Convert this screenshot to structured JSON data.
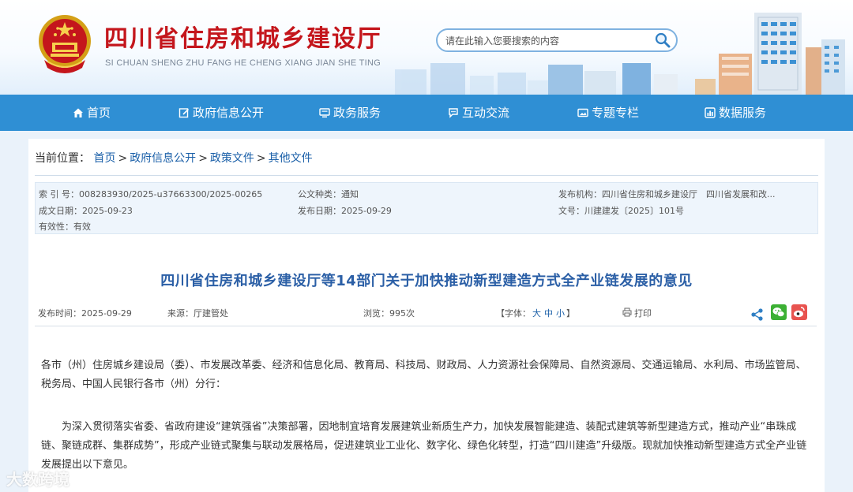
{
  "header": {
    "title": "四川省住房和城乡建设厅",
    "subtitle": "SI CHUAN SHENG ZHU FANG HE CHENG XIANG JIAN SHE TING",
    "search_placeholder": "请在此输入您要搜索的内容",
    "brand_color": "#c4161c"
  },
  "nav": {
    "color": "#2f8fd4",
    "items": [
      {
        "label": "首页",
        "icon": "home-icon"
      },
      {
        "label": "政府信息公开",
        "icon": "edit-icon"
      },
      {
        "label": "政务服务",
        "icon": "monitor-icon"
      },
      {
        "label": "互动交流",
        "icon": "chat-icon"
      },
      {
        "label": "专题专栏",
        "icon": "picture-icon"
      },
      {
        "label": "数据服务",
        "icon": "chart-icon"
      }
    ]
  },
  "breadcrumb": {
    "prefix": "当前位置：",
    "items": [
      "首页",
      "政府信息公开",
      "政策文件",
      "其他文件"
    ],
    "separator": ">"
  },
  "meta": {
    "index_no": "索 引 号：008283930/2025-u37663300/2025-00265",
    "doc_type": "公文种类：通知",
    "publisher": "发布机构：四川省住房和城乡建设厅　四川省发展和改...",
    "written_date": "成文日期：2025-09-23",
    "publish_date": "发布日期：2025-09-29",
    "doc_no": "文号：川建建发〔2025〕101号",
    "validity": "有效性：有效"
  },
  "article": {
    "title": "四川省住房和城乡建设厅等14部门关于加快推动新型建造方式全产业链发展的意见",
    "publish_time": "发布时间：2025-09-29",
    "source": "来源：厅建管处",
    "views": "浏览：995次",
    "font_label_prefix": "【字体：",
    "font_large": "大",
    "font_medium": "中",
    "font_small": "小",
    "font_label_suffix": "】",
    "print_label": "打印",
    "paragraph_1": "各市（州）住房城乡建设局（委）、市发展改革委、经济和信息化局、教育局、科技局、财政局、人力资源社会保障局、自然资源局、交通运输局、水利局、市场监管局、税务局、中国人民银行各市（州）分行：",
    "paragraph_2": "为深入贯彻落实省委、省政府建设“建筑强省”决策部署，因地制宜培育发展建筑业新质生产力，加快发展智能建造、装配式建筑等新型建造方式，推动产业“串珠成链、聚链成群、集群成势”，形成产业链式聚集与联动发展格局，促进建筑业工业化、数字化、绿色化转型，打造“四川建造”升级版。现就加快推动新型建造方式全产业链发展提出以下意见。"
  },
  "watermark": "大数跨境"
}
